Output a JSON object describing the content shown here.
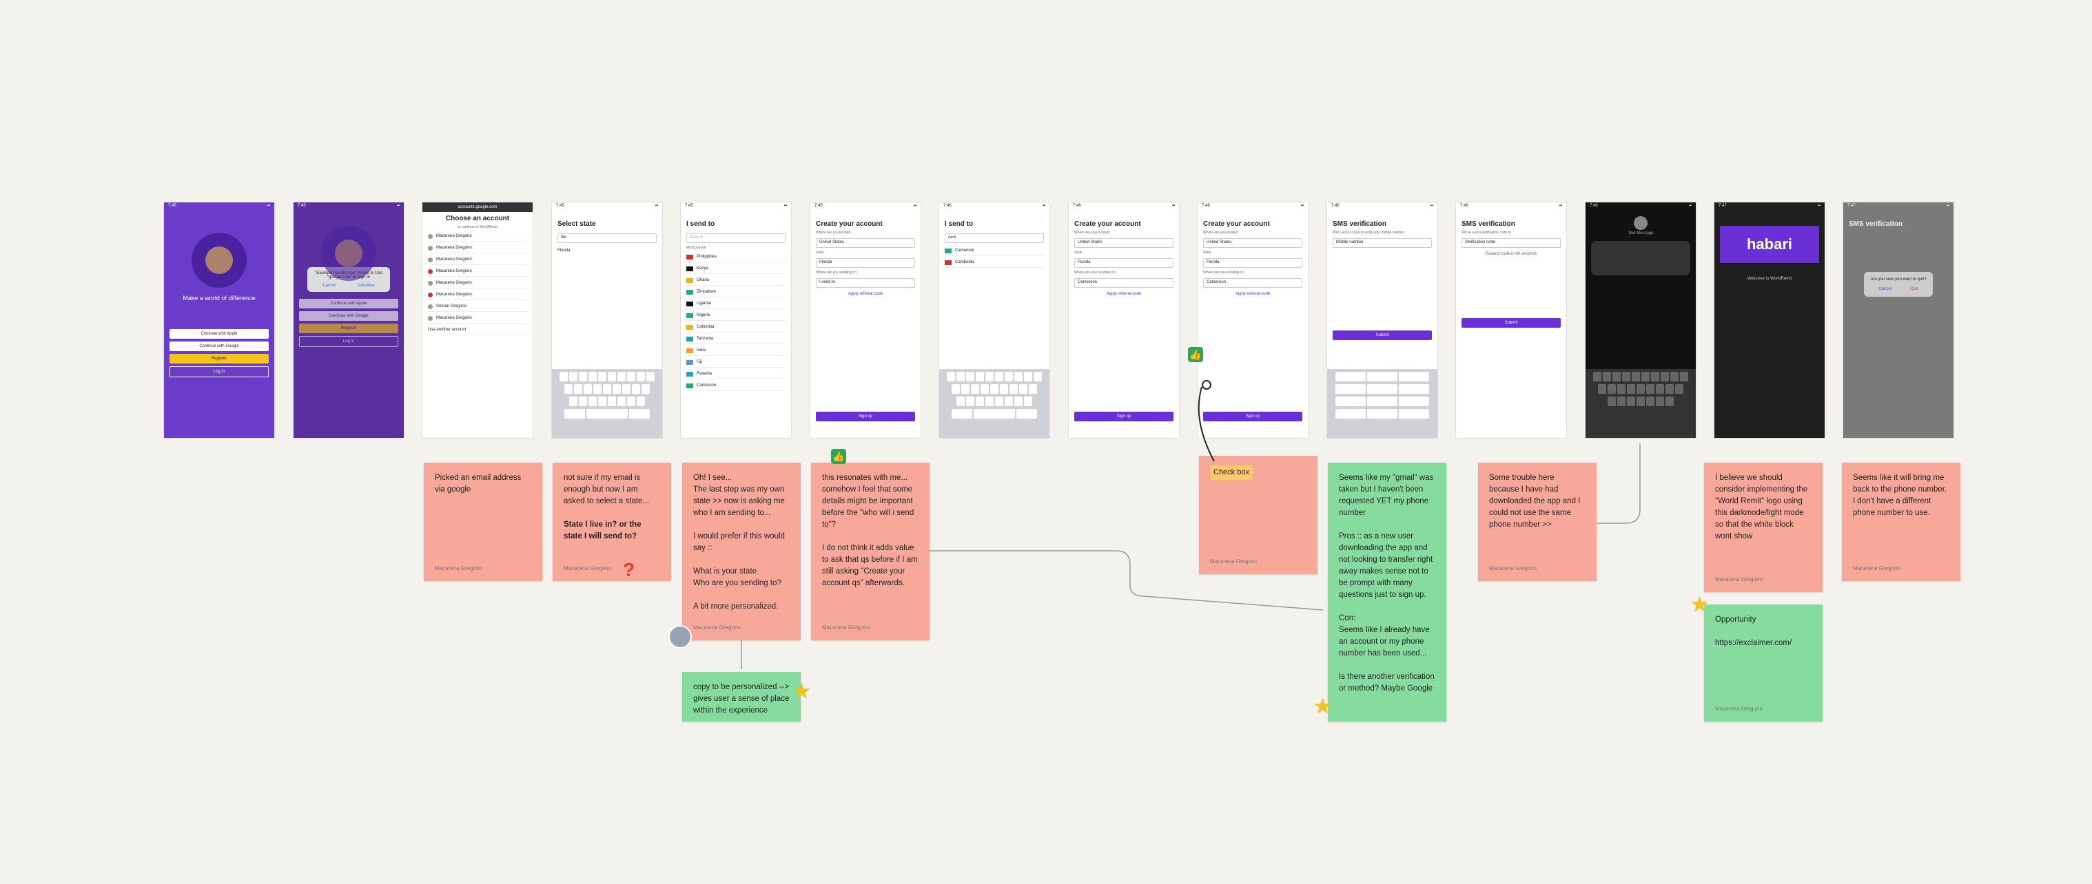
{
  "frames": [
    {
      "id": "welcome",
      "status_time": "7:45",
      "title": "Make a world of difference",
      "buttons": [
        "Continue with Apple",
        "Continue with Google",
        "Register",
        "Log in"
      ]
    },
    {
      "id": "google-permission",
      "status_time": "7:45",
      "dialog": "\"ExampleTransferApp\" Wants to Use \"google.com\" to Sign In",
      "dialog_buttons": [
        "Cancel",
        "Continue"
      ],
      "buttons": [
        "Continue with Apple",
        "Continue with Google",
        "Register",
        "Log in"
      ]
    },
    {
      "id": "choose-account",
      "url": "accounts.google.com",
      "title": "Choose an account",
      "subtitle": "to continue to WorldRemit",
      "accounts": [
        "Macarena Gregorio",
        "Macarena Gregorio",
        "Macarena Gregorio",
        "Macarena Gregorio",
        "Macarena Gregorio",
        "Macarena Gregorio",
        "Sriman Gregorio",
        "Macarena Gregorio"
      ],
      "footer": "Use another account"
    },
    {
      "id": "select-state",
      "status_time": "7:45",
      "title": "Select state",
      "search_value": "flor",
      "result": "Florida"
    },
    {
      "id": "i-send-to",
      "status_time": "7:45",
      "title": "I send to",
      "search_placeholder": "Search",
      "section": "Most popular",
      "countries": [
        "Philippines",
        "Kenya",
        "Ghana",
        "Zimbabwe",
        "Uganda",
        "Nigeria",
        "Colombia",
        "Tanzania",
        "India",
        "Fiji",
        "Rwanda",
        "Cameroon"
      ]
    },
    {
      "id": "create-account-1",
      "status_time": "7:45",
      "title": "Create your account",
      "fields": [
        {
          "label": "Where are you located",
          "value": "United States"
        },
        {
          "label": "State",
          "value": "Florida"
        },
        {
          "label": "Where are you sending to?",
          "value": "I send to"
        }
      ],
      "link": "Apply referral code",
      "button": "Sign up"
    },
    {
      "id": "i-send-to-search",
      "status_time": "7:46",
      "title": "I send to",
      "search_value": "cam",
      "results": [
        "Cameroon",
        "Cambodia"
      ]
    },
    {
      "id": "create-account-2",
      "status_time": "7:46",
      "title": "Create your account",
      "fields": [
        {
          "label": "Where are you located",
          "value": "United States"
        },
        {
          "label": "State",
          "value": "Florida"
        },
        {
          "label": "Where are you sending to?",
          "value": "Cameroon"
        }
      ],
      "link": "Apply referral code",
      "button": "Sign up"
    },
    {
      "id": "create-account-3",
      "status_time": "7:46",
      "title": "Create your account",
      "fields": [
        {
          "label": "Where are you located",
          "value": "United States"
        },
        {
          "label": "State",
          "value": "Florida"
        },
        {
          "label": "Where are you sending to?",
          "value": "Cameroon"
        }
      ],
      "link": "Apply referral code",
      "button": "Sign up"
    },
    {
      "id": "sms-verification-1",
      "status_time": "7:46",
      "title": "SMS verification",
      "subtitle": "We'll send a code to verify your mobile number.",
      "field_value": "Mobile number",
      "button": "Submit"
    },
    {
      "id": "sms-verification-2",
      "status_time": "7:46",
      "title": "SMS verification",
      "subtitle": "We've sent a verification code to",
      "field_value": "Verification code",
      "link": "Resend code in 60 seconds",
      "button": "Submit"
    },
    {
      "id": "messages",
      "status_time": "7:46",
      "title": "Text Message"
    },
    {
      "id": "email",
      "status_time": "7:47",
      "brand": "habari",
      "heading": "Welcome to WorldRemit"
    },
    {
      "id": "sms-verification-exit",
      "status_time": "7:47",
      "title": "SMS verification",
      "dialog": "Are you sure you want to quit?",
      "dialog_buttons": [
        "Cancel",
        "Quit"
      ]
    }
  ],
  "stickies": [
    {
      "id": "s1",
      "text": "Picked an email address via google",
      "author": "Macarena Gregorio"
    },
    {
      "id": "s2",
      "text": "not sure if my email is enough but now I am asked to select a state...",
      "bold": "State I live in? or the state I will send to?",
      "author": "Macarena Gregorio"
    },
    {
      "id": "s3",
      "text": "Oh! I see...\nThe last step was my own state >> now is asking me who I am sending to...\n\nI would prefer if this would say ::\n\nWhat is your state\nWho are you sending to?\n\nA bit more personalized.",
      "author": "Macarena Gregorio"
    },
    {
      "id": "s4",
      "text": "this resonates with me... somehow I feel  that some details might be important before the \"who will i send to\"?\n\nI do not think it adds value to ask that qs before if I am still asking \"Create your account qs\" afterwards.",
      "author": "Macarena Gregorio"
    },
    {
      "id": "s5",
      "label": "Check box",
      "author": "Macarena Gregorio"
    },
    {
      "id": "s6",
      "text": "Seems like my \"gmail\" was taken but I haven't been requested YET my phone number\n\nPros :: as a new user downloading the app and not looking to transfer right away makes sense not to be prompt with many questions just to sign up.\n\nCon:\nSeems like I already have an account or my phone number has been used...\n\n Is there another verification or method? Maybe Google",
      "author": ""
    },
    {
      "id": "s7",
      "text": "Some trouble here because I have had downloaded the app and I could not use the same phone number >>",
      "author": "Macarena Gregorio"
    },
    {
      "id": "s8",
      "text": "I believe we should consider implementing the \"World Remit\" logo using this darkmode/light mode so that the white block wont show",
      "author": "Macarena Gregorio"
    },
    {
      "id": "s9",
      "text": "Seems like it will bring me back to the phone number. I don't have a different phone number to use.",
      "author": "Macarena Gregorio"
    },
    {
      "id": "s10",
      "text": "copy to be personalized --> gives user a sense of place within the experience",
      "author": ""
    },
    {
      "id": "s11",
      "text": "Opportunity\n\nhttps://exclaimer.com/",
      "author": "Macarena Gregorio"
    }
  ],
  "colors": {
    "background": "#f3f2ec",
    "salmon": "#f7a898",
    "green": "#86dc9f",
    "purple": "#6b2fd6",
    "yellow": "#f5c518"
  }
}
